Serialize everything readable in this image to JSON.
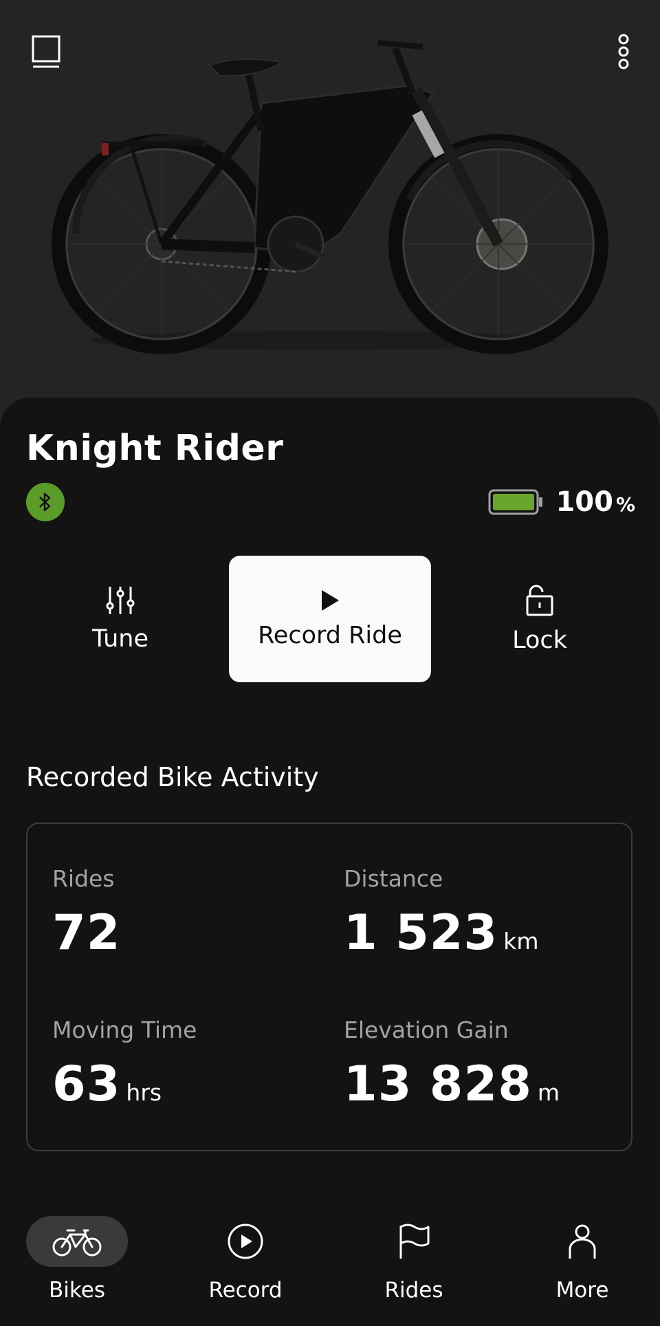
{
  "header": {
    "left_icon": "sidebar-panel-icon",
    "right_icon": "more-vertical-icon"
  },
  "bike": {
    "name": "Knight Rider",
    "connection_icon": "bluetooth-icon",
    "connection_color": "#5a9b2a",
    "battery": {
      "level": 1.0,
      "value": "100",
      "unit": "%",
      "color": "#6aa62f"
    }
  },
  "actions": [
    {
      "label": "Tune",
      "icon": "sliders-icon"
    },
    {
      "label": "Record Ride",
      "icon": "play-icon"
    },
    {
      "label": "Lock",
      "icon": "unlock-icon"
    }
  ],
  "activity": {
    "title": "Recorded Bike Activity",
    "stats": [
      {
        "label": "Rides",
        "value": "72",
        "unit": ""
      },
      {
        "label": "Distance",
        "value": "1 523",
        "unit": "km"
      },
      {
        "label": "Moving Time",
        "value": "63",
        "unit": "hrs"
      },
      {
        "label": "Elevation Gain",
        "value": "13 828",
        "unit": "m"
      }
    ]
  },
  "nav": {
    "active": "Bikes",
    "items": [
      {
        "label": "Bikes",
        "icon": "bike-icon"
      },
      {
        "label": "Record",
        "icon": "play-circle-icon"
      },
      {
        "label": "Rides",
        "icon": "flag-icon"
      },
      {
        "label": "More",
        "icon": "person-icon"
      }
    ]
  },
  "colors": {
    "background": "#131313",
    "hero": "#242424",
    "accent": "#5a9b2a"
  }
}
